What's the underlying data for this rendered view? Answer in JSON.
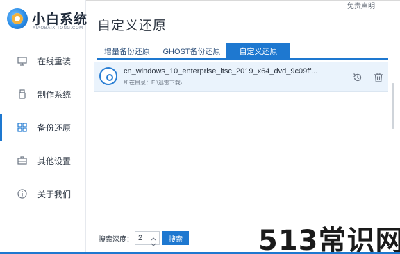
{
  "app": {
    "logo_title": "小白系统",
    "logo_sub": "XIAOBAIXITONG.COM",
    "window_link": "免责声明"
  },
  "sidebar": {
    "items": [
      {
        "label": "在线重装",
        "icon": "monitor-icon"
      },
      {
        "label": "制作系统",
        "icon": "usb-icon"
      },
      {
        "label": "备份还原",
        "icon": "backup-icon",
        "active": true
      },
      {
        "label": "其他设置",
        "icon": "toolbox-icon"
      },
      {
        "label": "关于我们",
        "icon": "info-icon"
      }
    ]
  },
  "main": {
    "title": "自定义还原",
    "tabs": [
      {
        "label": "增量备份还原"
      },
      {
        "label": "GHOST备份还原"
      },
      {
        "label": "自定义还原",
        "active": true
      }
    ],
    "files": [
      {
        "name": "cn_windows_10_enterprise_ltsc_2019_x64_dvd_9c09ff...",
        "dir": "所在目录：E:\\迅雷下载\\"
      }
    ]
  },
  "search": {
    "depth_label": "搜索深度：",
    "depth_value": "2",
    "button_label": "搜索"
  },
  "watermark": "513常识网",
  "colors": {
    "accent": "#1e78d0",
    "row_bg": "#eaf3fc",
    "text": "#2c3440"
  }
}
